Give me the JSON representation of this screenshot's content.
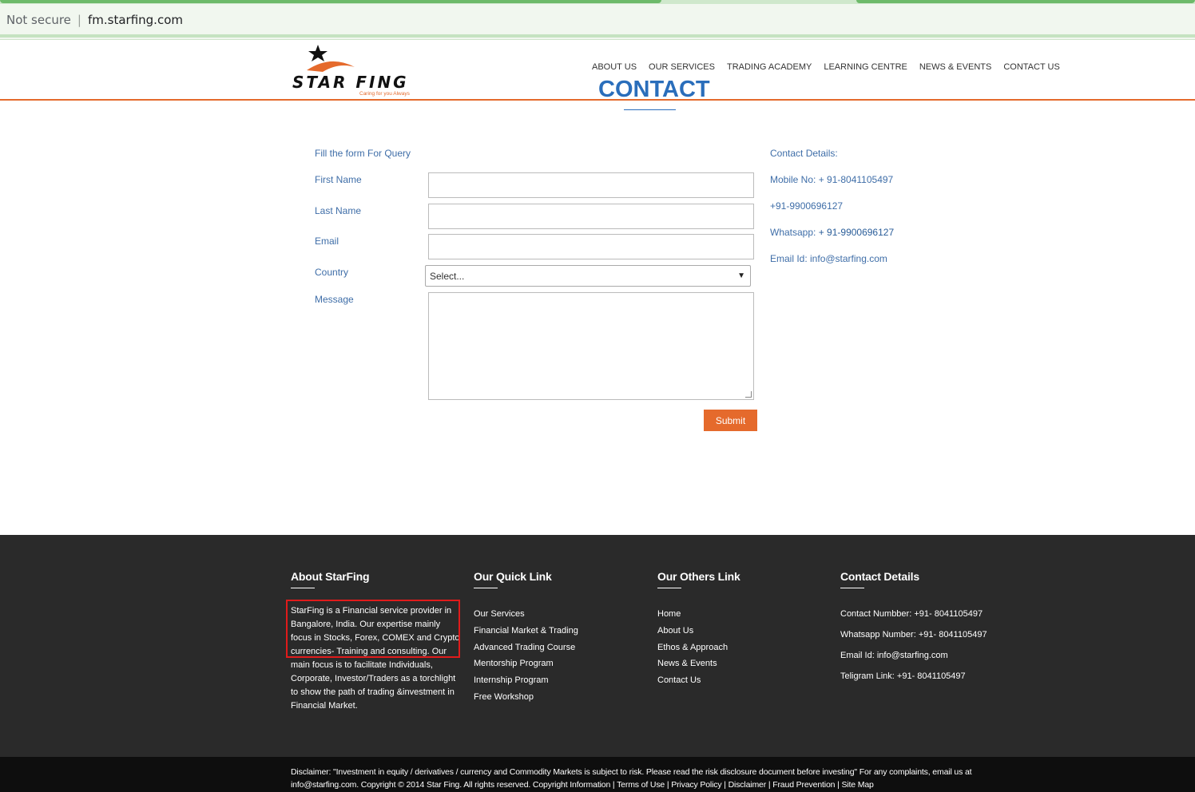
{
  "browser": {
    "security_label": "Not secure",
    "url": "fm.starfing.com"
  },
  "header": {
    "logo_text": "STAR FING",
    "logo_tagline": "Caring for you Always",
    "nav": [
      "ABOUT US",
      "OUR SERVICES",
      "TRADING ACADEMY",
      "LEARNING CENTRE",
      "NEWS & EVENTS",
      "CONTACT US"
    ],
    "page_title": "CONTACT"
  },
  "form": {
    "heading": "Fill the form For Query",
    "first_name_label": "First Name",
    "last_name_label": "Last Name",
    "email_label": "Email",
    "country_label": "Country",
    "country_selected": "Select...",
    "message_label": "Message",
    "submit_label": "Submit"
  },
  "contact_side": {
    "heading": "Contact Details:",
    "mobile": "Mobile No: + 91-8041105497",
    "mobile2": "+91-9900696127",
    "whatsapp_label": "Whatsapp: ",
    "whatsapp_number": "+ 91-9900696127",
    "email": "Email Id: info@starfing.com"
  },
  "footer": {
    "about_title": "About StarFing",
    "about_text": "StarFing is a Financial service provider in Bangalore, India. Our expertise mainly focus in Stocks, Forex, COMEX and Crypto currencies- Training and consulting. Our main focus is to facilitate Individuals, Corporate, Investor/Traders as a torchlight to show the path of trading &investment in Financial Market.",
    "quick_title": "Our Quick Link",
    "quick_links": [
      "Our Services",
      "Financial Market & Trading",
      "Advanced Trading Course",
      "Mentorship Program",
      "Internship Program",
      "Free Workshop"
    ],
    "others_title": "Our Others Link",
    "others_links": [
      "Home",
      "About Us",
      "Ethos & Approach",
      "News & Events",
      "Contact Us"
    ],
    "contact_title": "Contact Details",
    "contact_items": [
      "Contact Numbber: +91- 8041105497",
      "Whatsapp Number: +91- 8041105497",
      "Email Id: info@starfing.com",
      "Teligram Link: +91- 8041105497"
    ]
  },
  "disclaimer": {
    "text": "Disclaimer: \"Investment in equity / derivatives / currency and Commodity Markets is subject to risk. Please read the risk disclosure document before investing\" For any complaints, email us at info@starfing.com. Copyright © 2014 Star Fing. All rights reserved. Copyright Information | Terms of Use | Privacy Policy | Disclaimer | Fraud Prevention | Site Map"
  },
  "colors": {
    "accent_orange": "#e56a2c",
    "title_blue": "#2a6ebb",
    "footer_bg": "#2a2a2a"
  }
}
